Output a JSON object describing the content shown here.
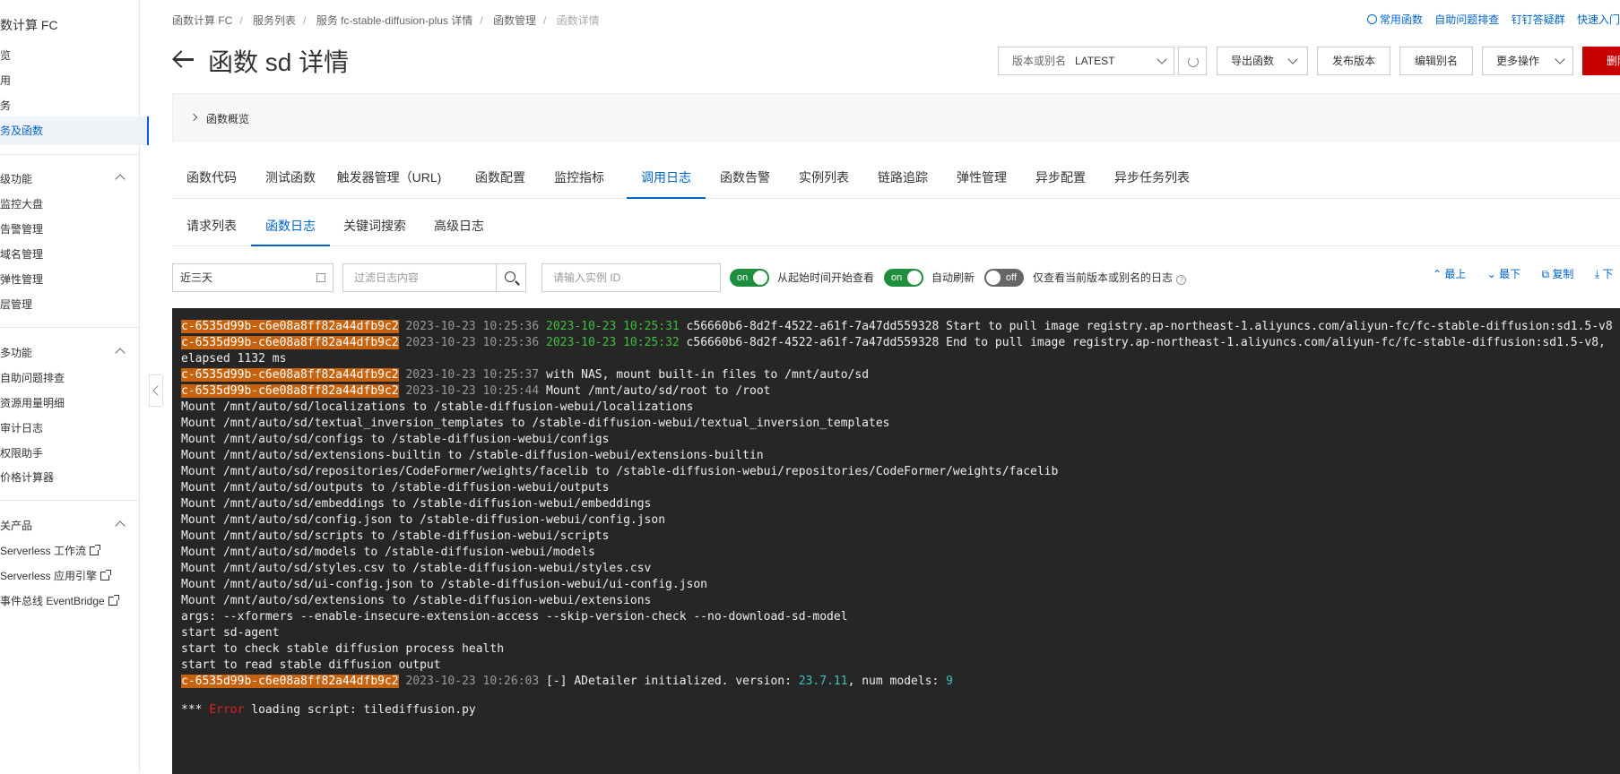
{
  "sidebar": {
    "title": "数计算 FC",
    "items": [
      "览",
      "用",
      "务",
      "务及函数"
    ],
    "group1": {
      "label": "级功能",
      "items": [
        "监控大盘",
        "告警管理",
        "域名管理",
        "弹性管理",
        "层管理"
      ]
    },
    "group2": {
      "label": "多功能",
      "items": [
        "自助问题排查",
        "资源用量明细",
        "审计日志",
        "权限助手",
        "价格计算器"
      ]
    },
    "group3": {
      "label": "关产品",
      "items": [
        "Serverless 工作流",
        "Serverless 应用引擎",
        "事件总线 EventBridge"
      ]
    }
  },
  "breadcrumb": [
    "函数计算 FC",
    "服务列表",
    "服务 fc-stable-diffusion-plus 详情",
    "函数管理",
    "函数详情"
  ],
  "toplinks": [
    "常用函数",
    "自助问题排查",
    "钉钉答疑群",
    "快速入门"
  ],
  "page_title": "函数 sd 详情",
  "actions": {
    "version_label": "版本或别名",
    "version_value": "LATEST",
    "export": "导出函数",
    "publish": "发布版本",
    "edit_alias": "编辑别名",
    "more": "更多操作",
    "delete": "删除"
  },
  "overview_label": "函数概览",
  "tabs": [
    "函数代码",
    "测试函数",
    "触发器管理（URL)",
    "函数配置",
    "监控指标",
    "调用日志",
    "函数告警",
    "实例列表",
    "链路追踪",
    "弹性管理",
    "异步配置",
    "异步任务列表"
  ],
  "active_tab": "调用日志",
  "subtabs": [
    "请求列表",
    "函数日志",
    "关键词搜索",
    "高级日志"
  ],
  "active_subtab": "函数日志",
  "filters": {
    "time_range": "近三天",
    "log_placeholder": "过滤日志内容",
    "instance_placeholder": "请输入实例 ID",
    "toggle1_state": "on",
    "toggle1_label": "从起始时间开始查看",
    "toggle2_state": "on",
    "toggle2_label": "自动刷新",
    "toggle3_state": "off",
    "toggle3_label": "仅查看当前版本或别名的日志",
    "top": "最上",
    "bottom": "最下",
    "copy": "复制",
    "download": "下"
  },
  "log": {
    "instance": "c-6535d99b-c6e08a8ff82a44dfb9c2",
    "lines": [
      {
        "rid": true,
        "ts": "2023-10-23 10:25:36",
        "gts": "2023-10-23 10:25:31",
        "text": " c56660b6-8d2f-4522-a61f-7a47dd559328 Start to pull image registry.ap-northeast-1.aliyuncs.com/aliyun-fc/fc-stable-diffusion:sd1.5-v8"
      },
      {
        "rid": true,
        "ts": "2023-10-23 10:25:36",
        "gts": "2023-10-23 10:25:32",
        "text": " c56660b6-8d2f-4522-a61f-7a47dd559328 End to pull image registry.ap-northeast-1.aliyuncs.com/aliyun-fc/fc-stable-diffusion:sd1.5-v8,"
      },
      {
        "text": "elapsed 1132 ms"
      },
      {
        "rid": true,
        "ts": "2023-10-23 10:25:37",
        "text": " with NAS, mount built-in files to /mnt/auto/sd"
      },
      {
        "rid": true,
        "ts": "2023-10-23 10:25:44",
        "text": " Mount /mnt/auto/sd/root to /root"
      },
      {
        "text": "Mount /mnt/auto/sd/localizations to /stable-diffusion-webui/localizations"
      },
      {
        "text": "Mount /mnt/auto/sd/textual_inversion_templates to /stable-diffusion-webui/textual_inversion_templates"
      },
      {
        "text": "Mount /mnt/auto/sd/configs to /stable-diffusion-webui/configs"
      },
      {
        "text": "Mount /mnt/auto/sd/extensions-builtin to /stable-diffusion-webui/extensions-builtin"
      },
      {
        "text": "Mount /mnt/auto/sd/repositories/CodeFormer/weights/facelib to /stable-diffusion-webui/repositories/CodeFormer/weights/facelib"
      },
      {
        "text": "Mount /mnt/auto/sd/outputs to /stable-diffusion-webui/outputs"
      },
      {
        "text": "Mount /mnt/auto/sd/embeddings to /stable-diffusion-webui/embeddings"
      },
      {
        "text": "Mount /mnt/auto/sd/config.json to /stable-diffusion-webui/config.json"
      },
      {
        "text": "Mount /mnt/auto/sd/scripts to /stable-diffusion-webui/scripts"
      },
      {
        "text": "Mount /mnt/auto/sd/models to /stable-diffusion-webui/models"
      },
      {
        "text": "Mount /mnt/auto/sd/styles.csv to /stable-diffusion-webui/styles.csv"
      },
      {
        "text": "Mount /mnt/auto/sd/ui-config.json to /stable-diffusion-webui/ui-config.json"
      },
      {
        "text": "Mount /mnt/auto/sd/extensions to /stable-diffusion-webui/extensions"
      },
      {
        "text": "args: --xformers --enable-insecure-extension-access --skip-version-check --no-download-sd-model"
      },
      {
        "text": "start sd-agent"
      },
      {
        "text": "start to check stable diffusion process health"
      },
      {
        "text": "start to read stable diffusion output"
      }
    ],
    "adetailer": {
      "ts": "2023-10-23 10:26:03",
      "prefix": " [-] ADetailer initialized. version: ",
      "version": "23.7.11",
      "mid": ", num models: ",
      "models": "9"
    },
    "error_line": {
      "prefix": "*** ",
      "error": "Error",
      "suffix": " loading script: tilediffusion.py"
    }
  },
  "colors": {
    "accent": "#0064c8",
    "danger": "#c80000",
    "instance_bg": "#c7620e",
    "console_bg": "#262626",
    "toggle_on": "#1e8e3e"
  }
}
